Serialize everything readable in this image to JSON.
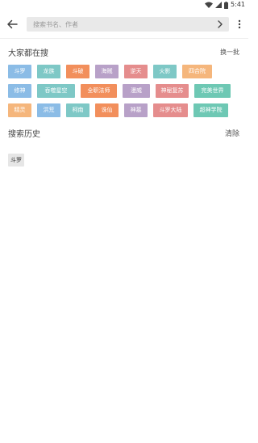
{
  "status": {
    "time": "5:41"
  },
  "search": {
    "placeholder": "搜索书名、作者"
  },
  "hot": {
    "title": "大家都在搜",
    "refresh_label": "换一批"
  },
  "tags": [
    [
      {
        "label": "斗罗",
        "color": "#8bbce6",
        "w": 29
      },
      {
        "label": "龙族",
        "color": "#7ec8c6",
        "w": 29
      },
      {
        "label": "斗破",
        "color": "#f28f5c",
        "w": 29
      },
      {
        "label": "海贼",
        "color": "#b8a1c8",
        "w": 29
      },
      {
        "label": "逆天",
        "color": "#e58d8d",
        "w": 29
      },
      {
        "label": "火影",
        "color": "#7ec8c6",
        "w": 29
      },
      {
        "label": "四合院",
        "color": "#f5b67c",
        "w": 37
      }
    ],
    [
      {
        "label": "修神",
        "color": "#8bbce6",
        "w": 29
      },
      {
        "label": "吞噬星空",
        "color": "#7ec8c6",
        "w": 47
      },
      {
        "label": "全职法师",
        "color": "#f28f5c",
        "w": 45
      },
      {
        "label": "漫威",
        "color": "#b8a1c8",
        "w": 34
      },
      {
        "label": "神秘复苏",
        "color": "#e58d8d",
        "w": 41
      },
      {
        "label": "完美世界",
        "color": "#6ec8b4",
        "w": 45
      }
    ],
    [
      {
        "label": "精灵",
        "color": "#f5b67c",
        "w": 29
      },
      {
        "label": "洪荒",
        "color": "#8bbce6",
        "w": 29
      },
      {
        "label": "柯南",
        "color": "#7ec8c6",
        "w": 29
      },
      {
        "label": "诛仙",
        "color": "#f28f5c",
        "w": 29
      },
      {
        "label": "神墓",
        "color": "#b8a1c8",
        "w": 29
      },
      {
        "label": "斗罗大陆",
        "color": "#e58d8d",
        "w": 43
      },
      {
        "label": "超神学院",
        "color": "#6ec8b4",
        "w": 43
      }
    ]
  ],
  "history": {
    "title": "搜索历史",
    "clear_label": "清除",
    "items": [
      "斗罗"
    ]
  }
}
